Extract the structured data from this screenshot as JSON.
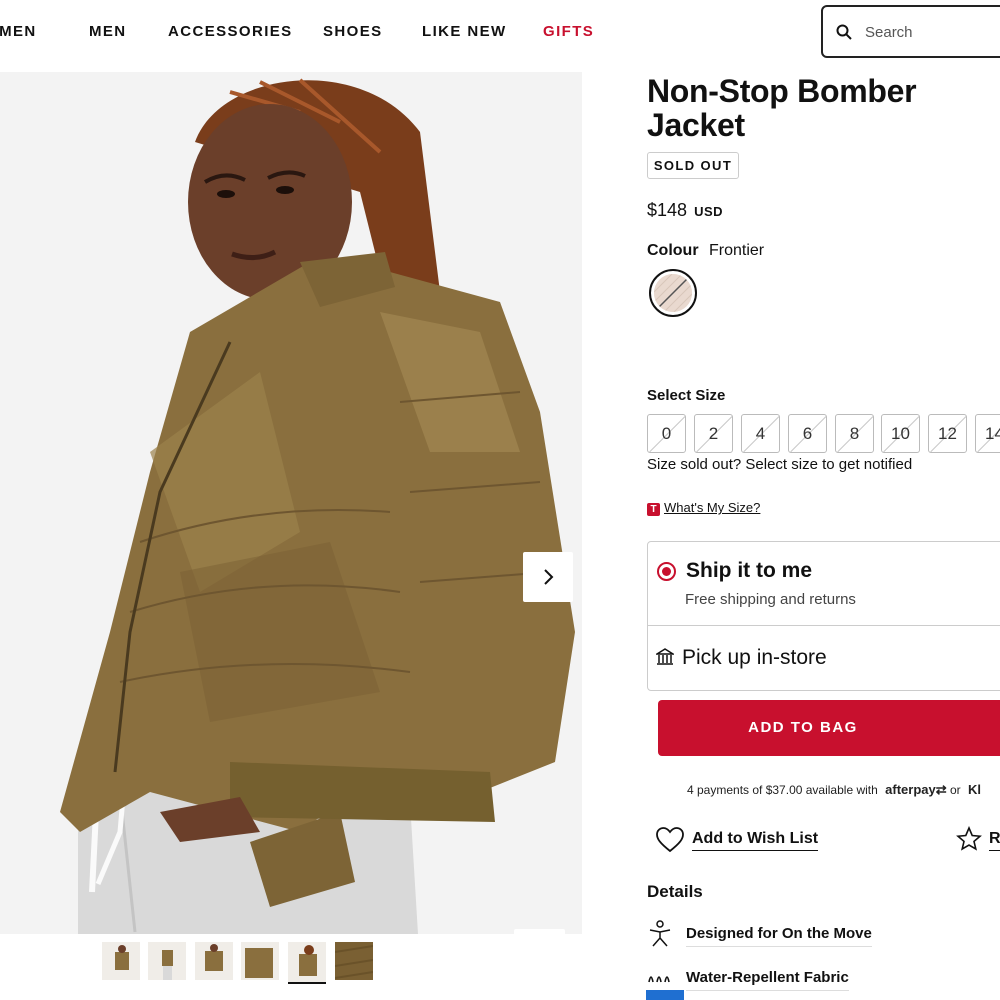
{
  "nav": {
    "items": [
      "OMEN",
      "MEN",
      "ACCESSORIES",
      "SHOES",
      "LIKE NEW",
      "GIFTS"
    ],
    "search_placeholder": "Search"
  },
  "gallery": {
    "next_icon": "chevron-right-icon",
    "zoom_icon": "zoom-in-icon",
    "thumbnail_count": 6,
    "active_thumbnail": 5
  },
  "product": {
    "title": "Non-Stop Bomber Jacket",
    "status_badge": "SOLD OUT",
    "price": "$148",
    "currency": "USD",
    "colour_label": "Colour",
    "colour_value": "Frontier",
    "size_label": "Select Size",
    "sizes": [
      "0",
      "2",
      "4",
      "6",
      "8",
      "10",
      "12",
      "14"
    ],
    "size_note": "Size sold out? Select size to get notified",
    "size_guide": {
      "badge": "T",
      "link": "What's My Size?"
    }
  },
  "delivery": {
    "ship_title": "Ship it to me",
    "ship_subtitle": "Free shipping and returns",
    "pickup_title": "Pick up in-store"
  },
  "actions": {
    "add_to_bag": "ADD TO BAG",
    "afterpay_text": "4 payments of $37.00 available with",
    "afterpay_brand": "afterpay",
    "or_text": "or",
    "klarna_partial": "Kl",
    "wishlist": "Add to Wish List",
    "review_partial": "R"
  },
  "details": {
    "heading": "Details",
    "features": [
      "Designed for On the Move",
      "Water-Repellent Fabric"
    ]
  },
  "colors": {
    "accent": "#c8102e",
    "jacket": "#8a6f3e",
    "background": "#f2f2f2"
  }
}
